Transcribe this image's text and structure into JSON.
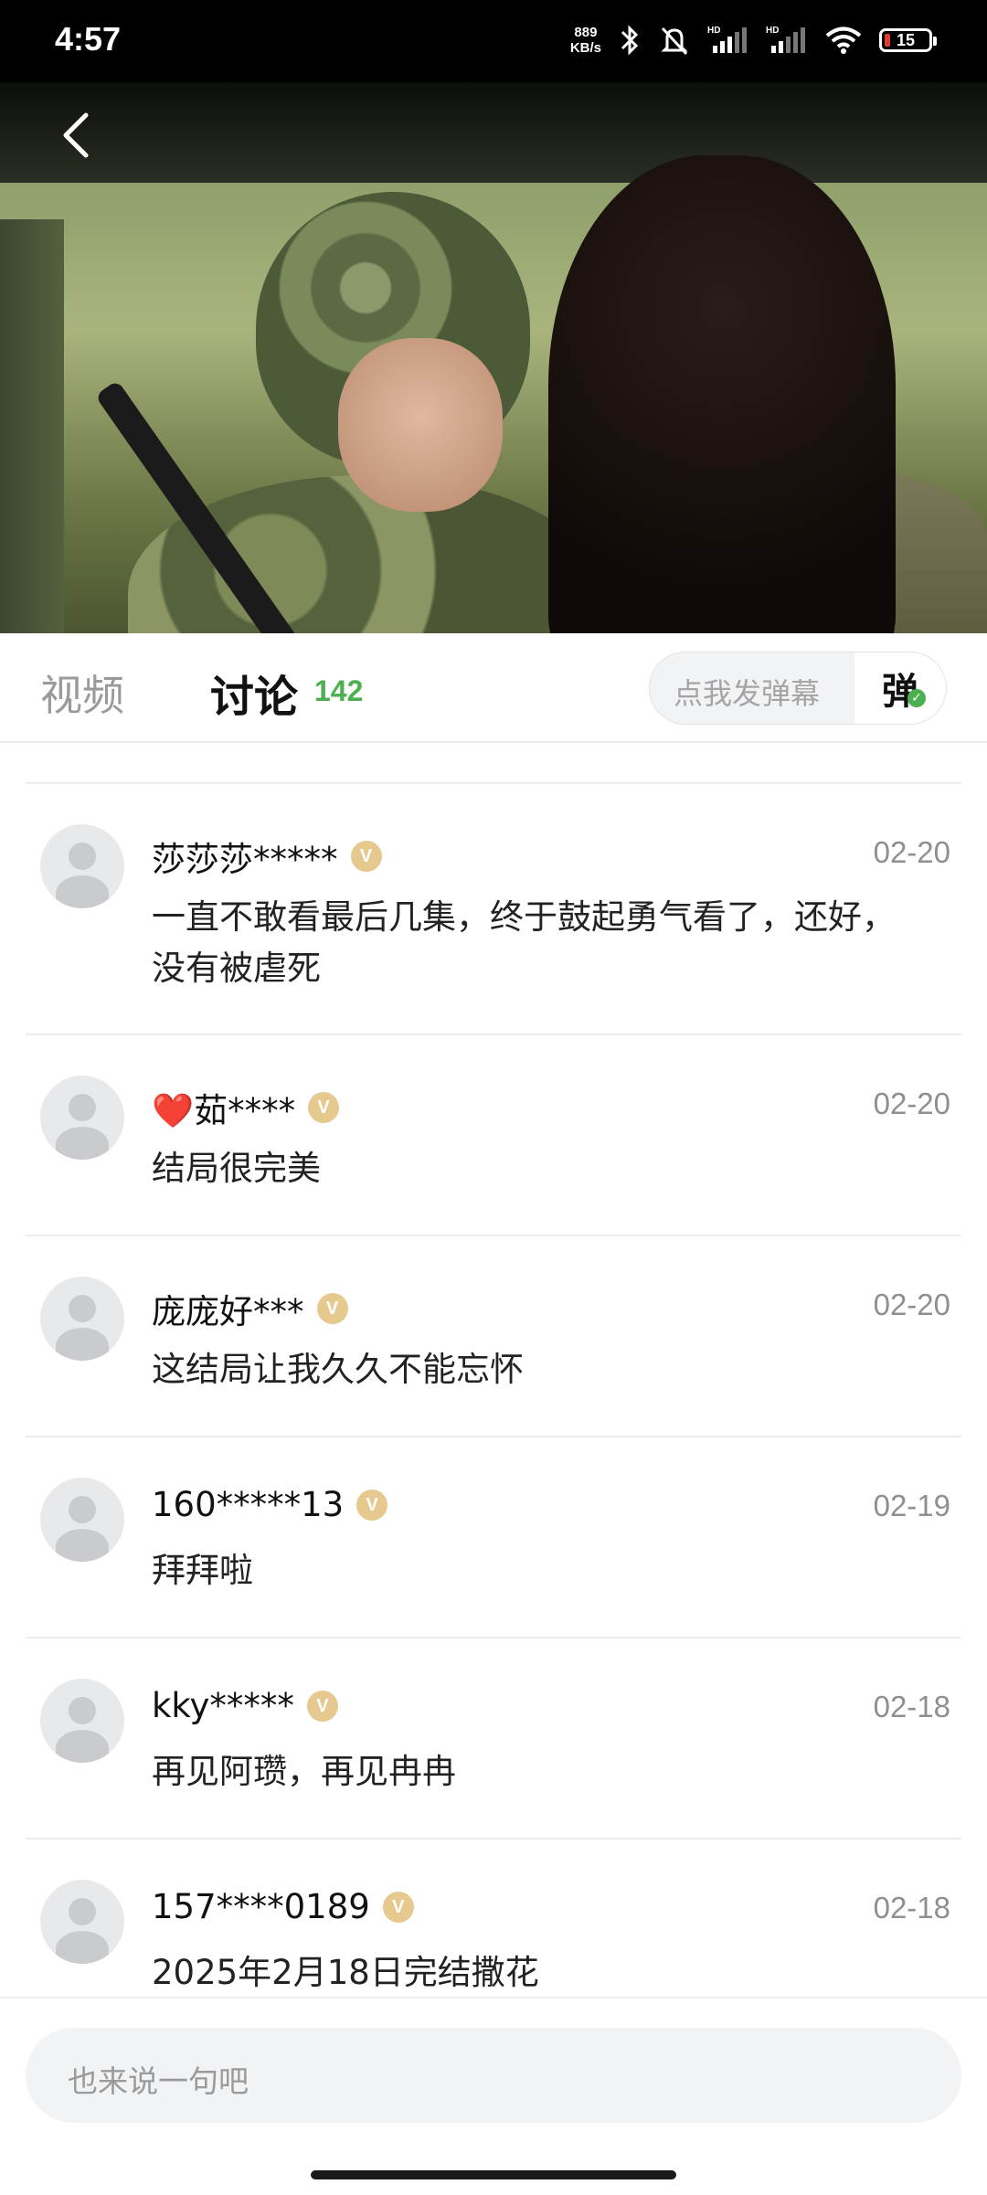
{
  "status_bar": {
    "time": "4:57",
    "net_speed_value": "889",
    "net_speed_unit": "KB/s",
    "battery": "15"
  },
  "tabs": {
    "video_label": "视频",
    "discuss_label": "讨论",
    "discuss_count": "142"
  },
  "danmu": {
    "placeholder": "点我发弹幕",
    "button_label": "弹"
  },
  "comments": [
    {
      "user": "莎莎莎*****",
      "date": "02-20",
      "text": "一直不敢看最后几集，终于鼓起勇气看了，还好，没有被虐死"
    },
    {
      "user": "❤️茹****",
      "date": "02-20",
      "text": "结局很完美"
    },
    {
      "user": "庞庞好***",
      "date": "02-20",
      "text": "这结局让我久久不能忘怀"
    },
    {
      "user": "160*****13",
      "date": "02-19",
      "text": "拜拜啦"
    },
    {
      "user": "kky*****",
      "date": "02-18",
      "text": "再见阿瓒，再见冉冉"
    },
    {
      "user": "157****0189",
      "date": "02-18",
      "text": "2025年2月18日完结撒花"
    }
  ],
  "bottom": {
    "input_placeholder": "也来说一句吧"
  },
  "badge_glyph": "V",
  "colors": {
    "accent_green": "#4caf50",
    "badge_gold": "#e5c98e"
  }
}
